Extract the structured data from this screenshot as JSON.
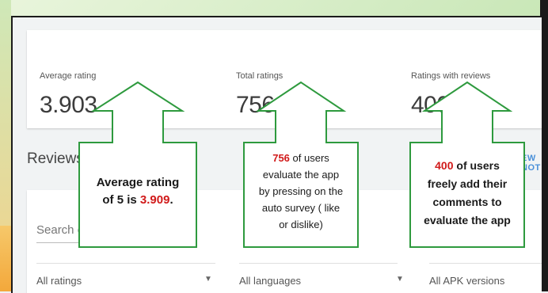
{
  "stats": {
    "average_rating": {
      "label": "Average rating",
      "value": "3.903",
      "star": "★"
    },
    "total_ratings": {
      "label": "Total ratings",
      "value": "756"
    },
    "ratings_with_reviews": {
      "label": "Ratings with reviews",
      "value": "400"
    }
  },
  "reviews": {
    "title": "Reviews",
    "view_link_partial": "EW NOT",
    "search_placeholder": "Search or",
    "filters": [
      {
        "label": "All ratings",
        "caret": "▼"
      },
      {
        "label": "All languages",
        "caret": "▼"
      },
      {
        "label": "All APK versions"
      }
    ]
  },
  "callouts": {
    "average": {
      "line1": "Average rating",
      "line2_prefix": "of 5 is ",
      "value": "3.909",
      "line2_suffix": "."
    },
    "total": {
      "value": "756",
      "line1_suffix": " of users",
      "line2": "evaluate the app",
      "line3": "by pressing on the",
      "line4": "auto survey ( like",
      "line5": "or dislike)"
    },
    "reviews": {
      "value": "400",
      "line1_suffix": " of users",
      "line2": "freely add their",
      "line3": "comments to",
      "line4": "evaluate the app"
    }
  },
  "colors": {
    "callout_border": "#2e9a3e",
    "highlight": "#d11a1a",
    "star": "#a6c95a"
  }
}
